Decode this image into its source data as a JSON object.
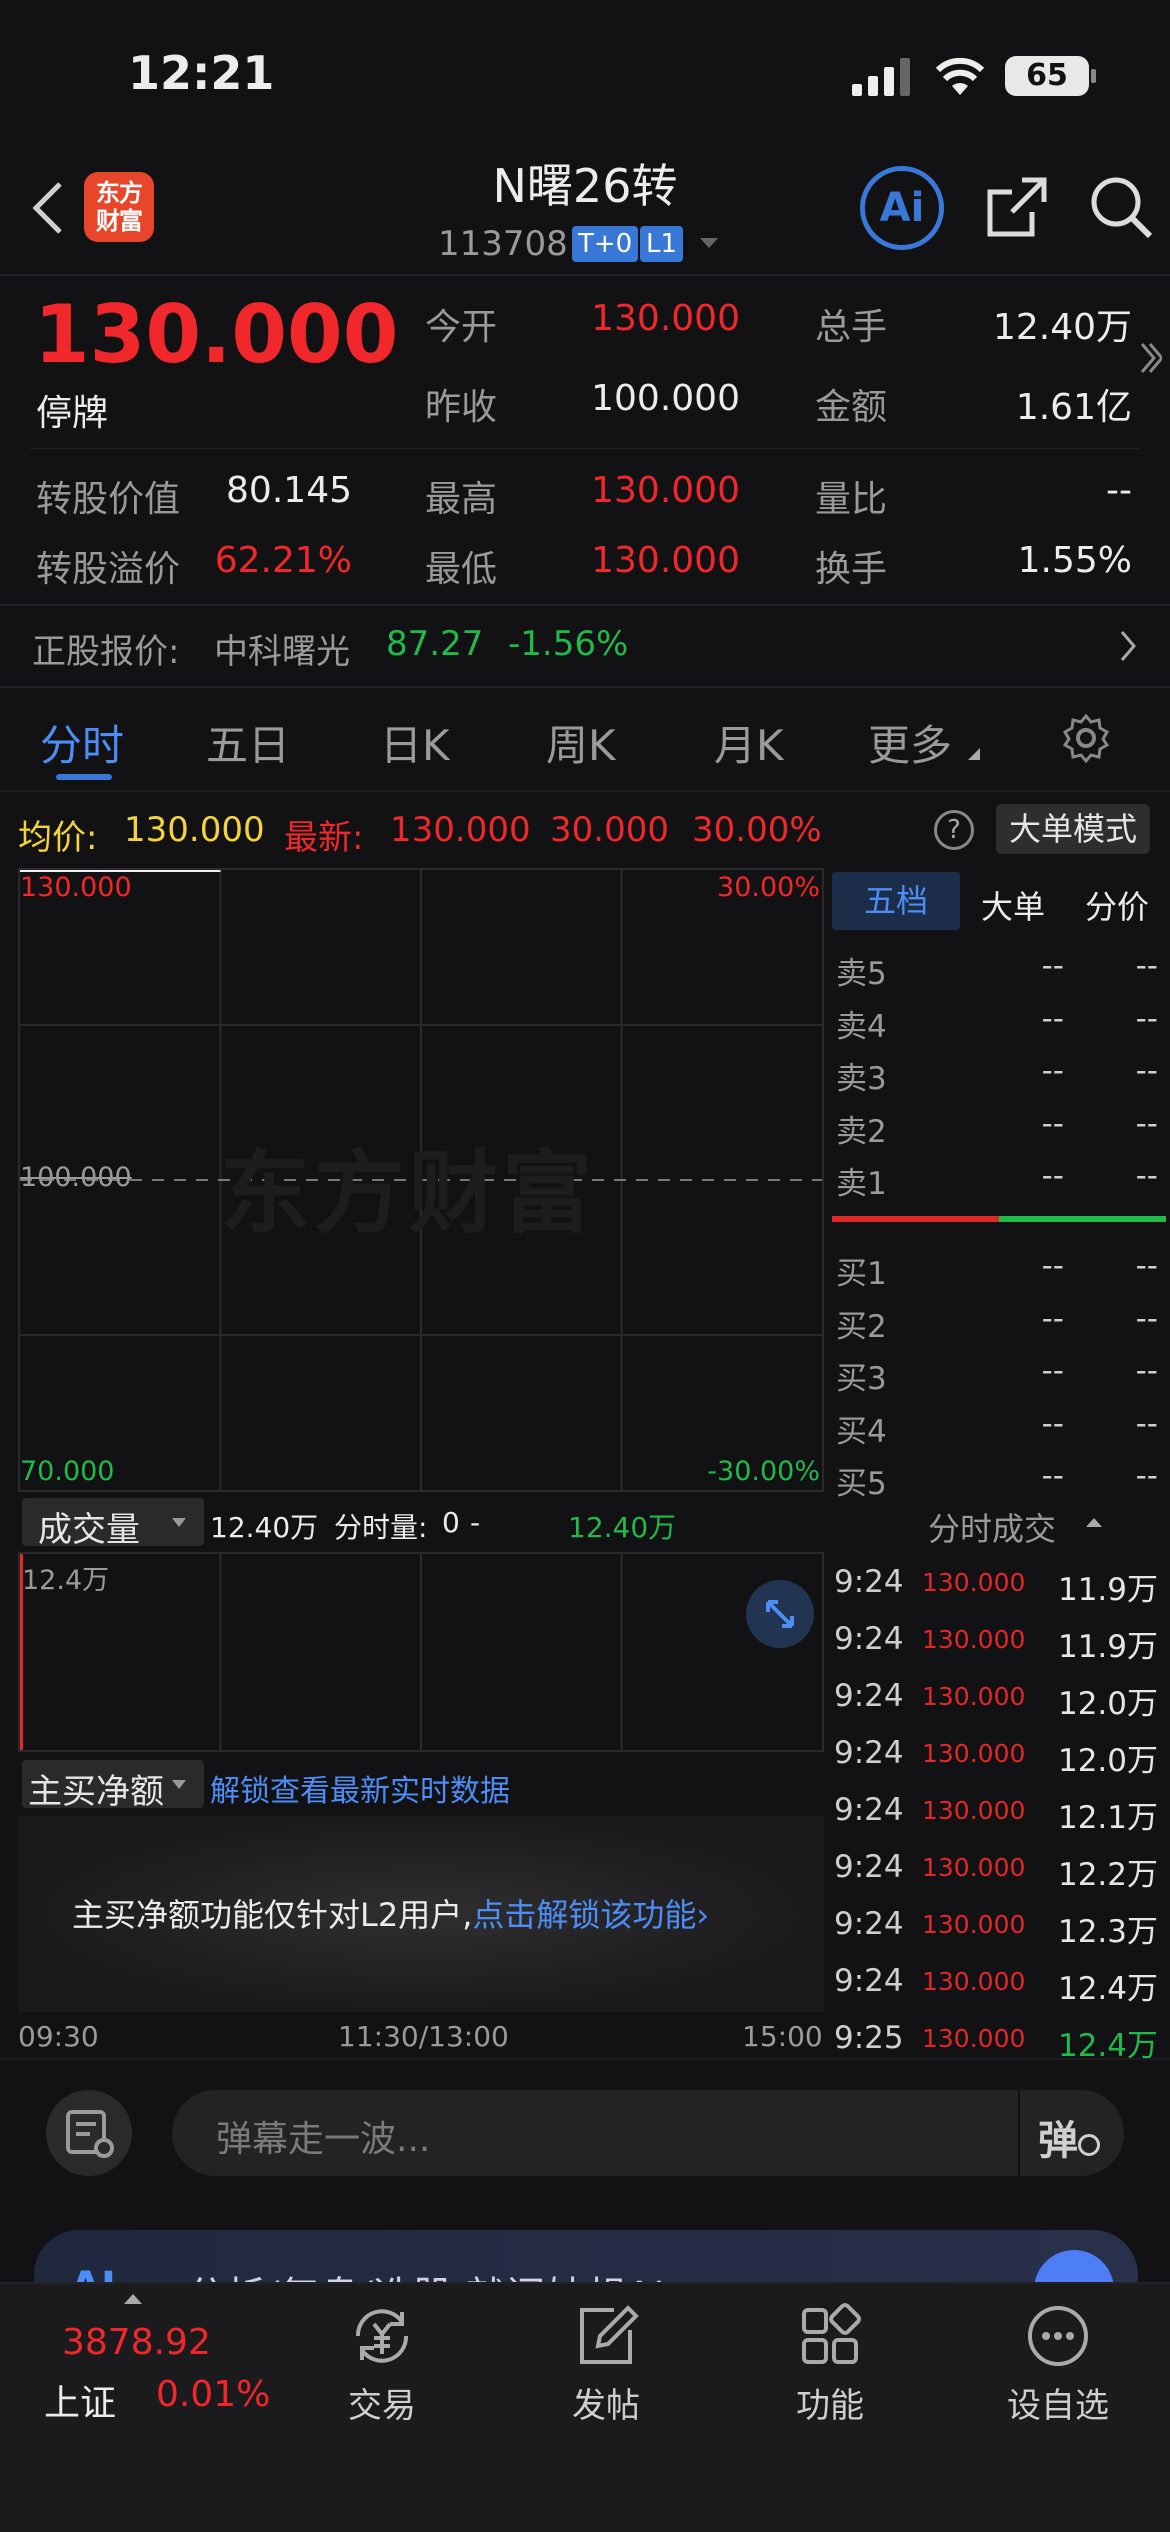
{
  "status_bar": {
    "time": "12:21",
    "battery": "65"
  },
  "header": {
    "title": "N曙26转",
    "code": "113708",
    "badge_t0": "T+0",
    "badge_l1": "L1",
    "logo_text": "东方财富",
    "ai_label": "Ai"
  },
  "quote": {
    "price": "130.000",
    "status": "停牌",
    "open_label": "今开",
    "open": "130.000",
    "prev_close_label": "昨收",
    "prev_close": "100.000",
    "volume_label": "总手",
    "volume": "12.40万",
    "amount_label": "金额",
    "amount": "1.61亿",
    "conv_value_label": "转股价值",
    "conv_value": "80.145",
    "conv_premium_label": "转股溢价",
    "conv_premium": "62.21%",
    "high_label": "最高",
    "high": "130.000",
    "low_label": "最低",
    "low": "130.000",
    "vol_ratio_label": "量比",
    "vol_ratio": "--",
    "turnover_label": "换手",
    "turnover": "1.55%"
  },
  "underlying": {
    "label": "正股报价:",
    "name": "中科曙光",
    "price": "87.27",
    "change": "-1.56%"
  },
  "tabs": [
    "分时",
    "五日",
    "日K",
    "周K",
    "月K",
    "更多"
  ],
  "chart_info": {
    "avg_label": "均价:",
    "avg": "130.000",
    "latest_label": "最新:",
    "latest": "130.000",
    "change": "30.000",
    "pct": "30.00%",
    "mode_button": "大单模式"
  },
  "chart_data": {
    "type": "line",
    "ylim": [
      70,
      130
    ],
    "reference_y": 100,
    "y_ticks_left": [
      "130.000",
      "100.000",
      "70.000"
    ],
    "y_ticks_right": [
      "30.00%",
      "-30.00%"
    ],
    "x_ticks": [
      "09:30",
      "11:30/13:00",
      "15:00"
    ],
    "series": [
      {
        "x": [
          "09:30",
          "10:30"
        ],
        "values": [
          130,
          130
        ]
      }
    ],
    "watermark": "东方财富"
  },
  "volume_panel": {
    "dropdown": "成交量",
    "total": "12.40万",
    "minute_label": "分时量:",
    "minute_value": "0",
    "sep": "-",
    "right_value": "12.40万",
    "peak": "12.4万"
  },
  "net_buy_panel": {
    "dropdown": "主买净额",
    "unlock_link": "解锁查看最新实时数据",
    "notice": "主买净额功能仅针对L2用户,",
    "notice_link": "点击解锁该功能"
  },
  "order_book": {
    "tabs": [
      "五档",
      "大单",
      "分价"
    ],
    "sells": [
      {
        "label": "卖5",
        "price": "--",
        "vol": "--"
      },
      {
        "label": "卖4",
        "price": "--",
        "vol": "--"
      },
      {
        "label": "卖3",
        "price": "--",
        "vol": "--"
      },
      {
        "label": "卖2",
        "price": "--",
        "vol": "--"
      },
      {
        "label": "卖1",
        "price": "--",
        "vol": "--"
      }
    ],
    "buys": [
      {
        "label": "买1",
        "price": "--",
        "vol": "--"
      },
      {
        "label": "买2",
        "price": "--",
        "vol": "--"
      },
      {
        "label": "买3",
        "price": "--",
        "vol": "--"
      },
      {
        "label": "买4",
        "price": "--",
        "vol": "--"
      },
      {
        "label": "买5",
        "price": "--",
        "vol": "--"
      }
    ]
  },
  "trades": {
    "title": "分时成交",
    "rows": [
      {
        "time": "9:24",
        "price": "130.000",
        "vol": "11.9万"
      },
      {
        "time": "9:24",
        "price": "130.000",
        "vol": "11.9万"
      },
      {
        "time": "9:24",
        "price": "130.000",
        "vol": "12.0万"
      },
      {
        "time": "9:24",
        "price": "130.000",
        "vol": "12.0万"
      },
      {
        "time": "9:24",
        "price": "130.000",
        "vol": "12.1万"
      },
      {
        "time": "9:24",
        "price": "130.000",
        "vol": "12.2万"
      },
      {
        "time": "9:24",
        "price": "130.000",
        "vol": "12.3万"
      },
      {
        "time": "9:24",
        "price": "130.000",
        "vol": "12.4万"
      },
      {
        "time": "9:25",
        "price": "130.000",
        "vol": "12.4万"
      }
    ]
  },
  "comment": {
    "placeholder": "弹幕走一波...",
    "danmu": "弹"
  },
  "ai_banner": {
    "text": "分析/复盘/选股,就问妙想AI"
  },
  "bottom_nav": {
    "index_value": "3878.92",
    "index_name": "上证",
    "index_change": "0.01%",
    "trade": "交易",
    "post": "发帖",
    "function": "功能",
    "watchlist": "设自选"
  }
}
